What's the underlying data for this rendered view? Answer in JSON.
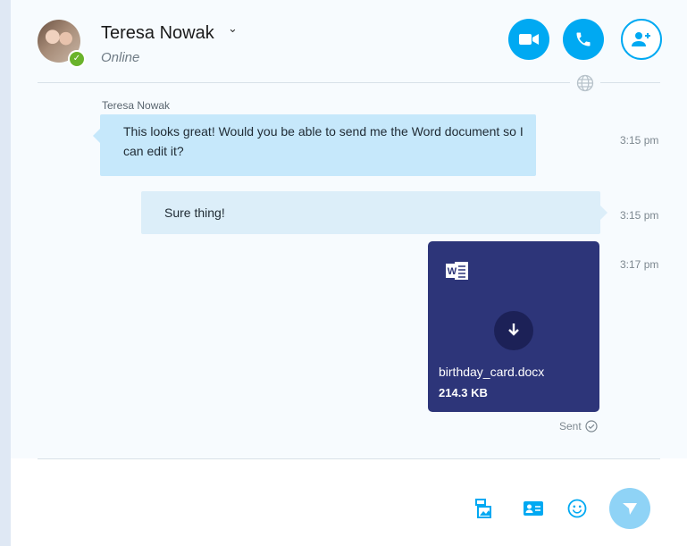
{
  "header": {
    "contact_name": "Teresa Nowak",
    "status": "Online",
    "buttons": {
      "video": "video-call",
      "audio": "audio-call",
      "add_people": "add-people"
    }
  },
  "messages": [
    {
      "sender": "Teresa Nowak",
      "direction": "incoming",
      "text": "This looks great! Would you be able to send me the Word document so I can edit it?",
      "time": "3:15 pm"
    },
    {
      "direction": "outgoing",
      "text": "Sure thing!",
      "time": "3:15 pm"
    },
    {
      "direction": "outgoing",
      "type": "file",
      "file_name": "birthday_card.docx",
      "file_size": "214.3 KB",
      "time": "3:17 pm",
      "status": "Sent"
    }
  ],
  "colors": {
    "accent": "#00a9f2",
    "file_card": "#2d3579",
    "incoming_bubble": "#c6e8fb",
    "outgoing_bubble": "#dceef9",
    "presence_online": "#6ab32b"
  }
}
